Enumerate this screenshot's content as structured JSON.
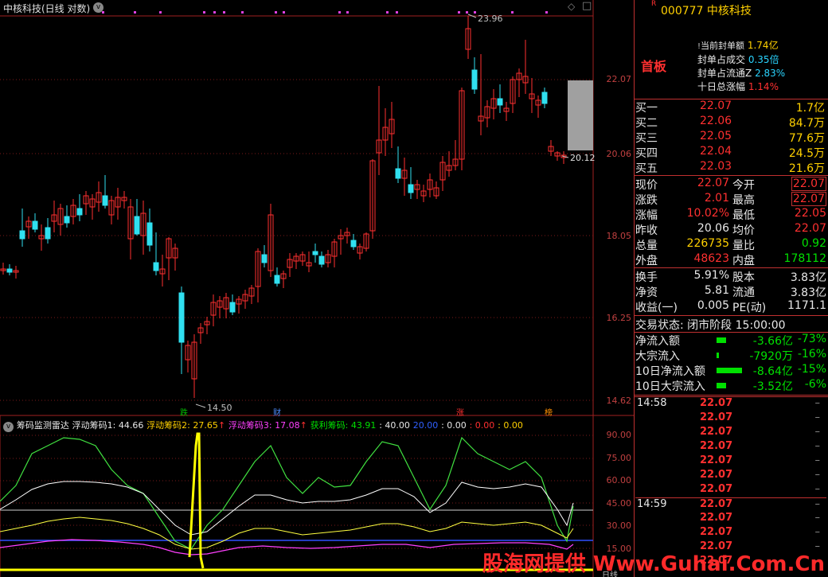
{
  "header": {
    "title": "中核科技(日线 对数)",
    "collapse_glyph": "v",
    "diamond_glyph": "◇",
    "box_glyph": "□"
  },
  "price_axis": [
    "22.07",
    "20.06",
    "18.05",
    "16.25",
    "14.62"
  ],
  "price_annotations": {
    "high": "23.96",
    "low": "14.50",
    "last": "20.12"
  },
  "markers": [
    {
      "label": "跌",
      "color": "#00c000"
    },
    {
      "label": "财",
      "color": "#4a8cff"
    },
    {
      "label": "涨",
      "color": "#ff3030"
    },
    {
      "label": "榜",
      "color": "#ff9000"
    }
  ],
  "indicator": {
    "title": "筹码监测雷达",
    "s1": "浮动筹码1: 44.66",
    "s2": "浮动筹码2: 27.65",
    "s3": "浮动筹码3: 17.08",
    "s4": "获利筹码: 43.91",
    "v1": ": 40.00",
    "v2": "20.00",
    "v3": ": 0.00",
    "v4": ": 0.00",
    "v5": ": 0.00",
    "axis": [
      "90.00",
      "75.00",
      "60.00",
      "45.00",
      "30.00",
      "15.00"
    ],
    "colors": {
      "s1": "#ffffff",
      "s2": "#ffff00",
      "s3": "#ff40ff",
      "s4": "#40e040"
    },
    "bottom_label": "日线"
  },
  "quote": {
    "code": "000777",
    "name": "中核科技",
    "flag": "R",
    "board": "首板",
    "seal_info": [
      {
        "label": "当前封单额",
        "value": "1.74亿",
        "color": "#ffd000"
      },
      {
        "label": "封单占成交",
        "value": "0.35倍",
        "color": "#2ad4ff"
      },
      {
        "label": "封单占流通Z",
        "value": "2.83%",
        "color": "#2ad4ff"
      },
      {
        "label": "十日总涨幅",
        "value": "1.14%",
        "color": "#ff3030"
      }
    ],
    "bids": [
      {
        "label": "买一",
        "price": "22.07",
        "vol": "1.7亿"
      },
      {
        "label": "买二",
        "price": "22.06",
        "vol": "84.7万"
      },
      {
        "label": "买三",
        "price": "22.05",
        "vol": "77.6万"
      },
      {
        "label": "买四",
        "price": "22.04",
        "vol": "24.5万"
      },
      {
        "label": "买五",
        "price": "22.03",
        "vol": "21.6万"
      }
    ],
    "stats": [
      {
        "l1": "现价",
        "v1": "22.07",
        "c1": "#ff3030",
        "l2": "今开",
        "v2": "22.07",
        "c2": "#ff3030",
        "boxed": true
      },
      {
        "l1": "涨跌",
        "v1": "2.01",
        "c1": "#ff3030",
        "l2": "最高",
        "v2": "22.07",
        "c2": "#ff3030",
        "boxed": true
      },
      {
        "l1": "涨幅",
        "v1": "10.02%",
        "c1": "#ff3030",
        "l2": "最低",
        "v2": "22.05",
        "c2": "#ff3030",
        "boxed": false
      },
      {
        "l1": "昨收",
        "v1": "20.06",
        "c1": "#e8e8e8",
        "l2": "均价",
        "v2": "22.07",
        "c2": "#ff3030",
        "boxed": false
      },
      {
        "l1": "总量",
        "v1": "226735",
        "c1": "#ffd000",
        "l2": "量比",
        "v2": "0.92",
        "c2": "#00e000",
        "boxed": false
      },
      {
        "l1": "外盘",
        "v1": "48623",
        "c1": "#ff3030",
        "l2": "内盘",
        "v2": "178112",
        "c2": "#00e000",
        "boxed": false
      }
    ],
    "fund": [
      {
        "l1": "换手",
        "v1": "5.91%",
        "l2": "股本",
        "v2": "3.83亿"
      },
      {
        "l1": "净资",
        "v1": "5.81",
        "l2": "流通",
        "v2": "3.83亿"
      },
      {
        "l1": "收益(一)",
        "v1": "0.005",
        "l2": "PE(动)",
        "v2": "1171.1"
      }
    ],
    "trade_state": {
      "label": "交易状态:",
      "value": "闭市阶段",
      "time": "15:00:00"
    },
    "flows": [
      {
        "label": "净流入额",
        "bar": 0.3,
        "value": "-3.66亿",
        "pct": "-73%"
      },
      {
        "label": "大宗流入",
        "bar": 0.05,
        "value": "-7920万",
        "pct": "-16%"
      },
      {
        "label": "10日净流入额",
        "bar": 0.8,
        "value": "-8.64亿",
        "pct": "-15%"
      },
      {
        "label": "10日大宗流入",
        "bar": 0.3,
        "value": "-3.52亿",
        "pct": "-6%"
      }
    ],
    "ticks": [
      {
        "time": "14:58",
        "price": "22.07"
      },
      {
        "time": "",
        "price": "22.07"
      },
      {
        "time": "",
        "price": "22.07"
      },
      {
        "time": "",
        "price": "22.07"
      },
      {
        "time": "",
        "price": "22.07"
      },
      {
        "time": "",
        "price": "22.07"
      },
      {
        "time": "",
        "price": "22.07"
      },
      {
        "time": "14:59",
        "price": "22.07"
      },
      {
        "time": "",
        "price": "22.07"
      },
      {
        "time": "",
        "price": "22.07"
      },
      {
        "time": "",
        "price": "22.07"
      },
      {
        "time": "",
        "price": "22.07"
      }
    ]
  },
  "watermark": "股海网提供 Www.Guhai.Com.Cn"
}
